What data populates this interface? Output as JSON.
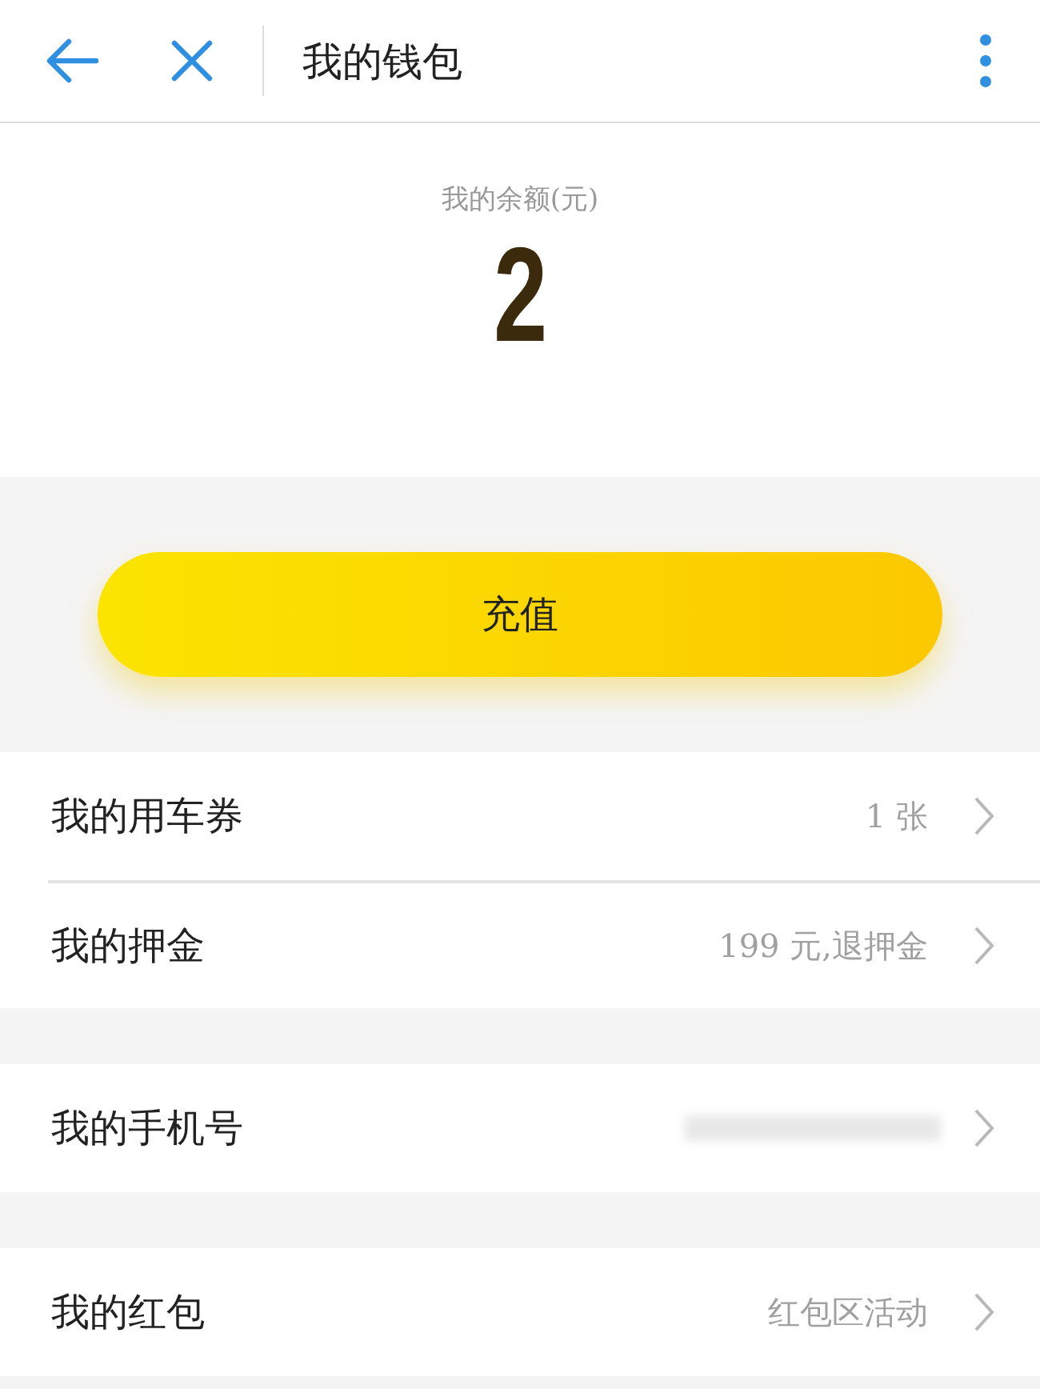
{
  "header": {
    "title": "我的钱包"
  },
  "balance": {
    "label": "我的余额(元)",
    "amount": "2"
  },
  "recharge_button": "充值",
  "groups": [
    {
      "rows": [
        {
          "label": "我的用车券",
          "kind": "text",
          "value": "1 张"
        },
        {
          "label": "我的押金",
          "kind": "text",
          "value": "199 元,退押金"
        }
      ]
    },
    {
      "rows": [
        {
          "label": "我的手机号",
          "kind": "redacted"
        }
      ]
    },
    {
      "rows": [
        {
          "label": "我的红包",
          "kind": "text",
          "value": "红包区活动"
        }
      ]
    }
  ]
}
